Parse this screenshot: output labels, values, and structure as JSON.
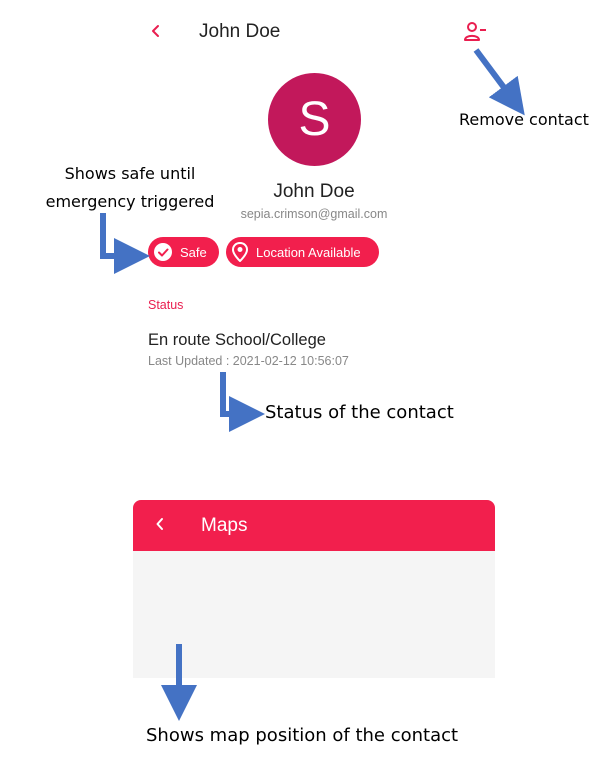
{
  "header": {
    "back_icon": "chevron-left-icon",
    "title": "John Doe",
    "remove_icon": "remove-person-icon"
  },
  "profile": {
    "avatar_letter": "S",
    "avatar_color": "#c2185b",
    "name": "John Doe",
    "email": "sepia.crimson@gmail.com"
  },
  "chips": {
    "safe_label": "Safe",
    "location_label": "Location Available",
    "color": "#f21f4d"
  },
  "status": {
    "heading": "Status",
    "text": "En route School/College",
    "last_updated": "Last Updated : 2021-02-12 10:56:07"
  },
  "maps": {
    "title": "Maps",
    "bar_color": "#f21f4d"
  },
  "annotations": {
    "remove_contact": "Remove contact",
    "safe_line1": "Shows safe until",
    "safe_line2": "emergency triggered",
    "status_contact": "Status of the contact",
    "map_position": "Shows map position of the contact",
    "arrow_color": "#4472c4"
  }
}
